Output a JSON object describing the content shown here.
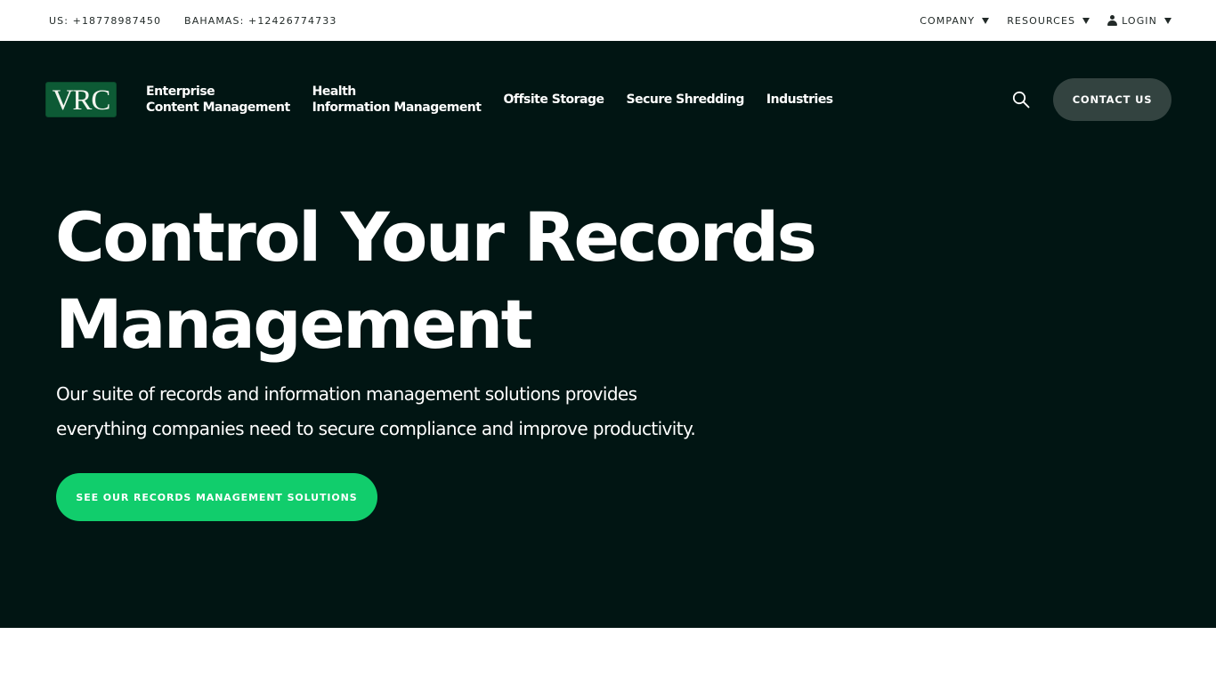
{
  "utility_bar": {
    "phones": [
      {
        "label": "US: +18778987450"
      },
      {
        "label": "BAHAMAS: +12426774733"
      }
    ],
    "menus": [
      {
        "label": "COMPANY",
        "icon": "caret-down-icon"
      },
      {
        "label": "RESOURCES",
        "icon": "caret-down-icon"
      },
      {
        "label": "LOGIN",
        "leading_icon": "user-icon",
        "icon": "caret-down-icon"
      }
    ]
  },
  "header": {
    "logo_text": "VRC",
    "nav_items": [
      {
        "lines": [
          "Enterprise",
          "Content Management"
        ]
      },
      {
        "lines": [
          "Health",
          "Information Management"
        ]
      },
      {
        "lines": [
          "Offsite Storage"
        ]
      },
      {
        "lines": [
          "Secure Shredding"
        ]
      },
      {
        "lines": [
          "Industries"
        ]
      }
    ],
    "search_icon": "search-icon",
    "contact_label": "CONTACT US"
  },
  "hero": {
    "title_lines": [
      "Control Your Records",
      "Management"
    ],
    "subtitle_lines": [
      "Our suite of records and information management solutions provides",
      "everything companies need to secure compliance and improve productivity."
    ],
    "cta_label": "SEE OUR RECORDS MANAGEMENT SOLUTIONS"
  },
  "colors": {
    "hero_background": "#011513",
    "cta_green": "#11cd6c",
    "contact_button": "#334340",
    "logo_green": "#0d5a35",
    "utility_text": "#222a28"
  }
}
